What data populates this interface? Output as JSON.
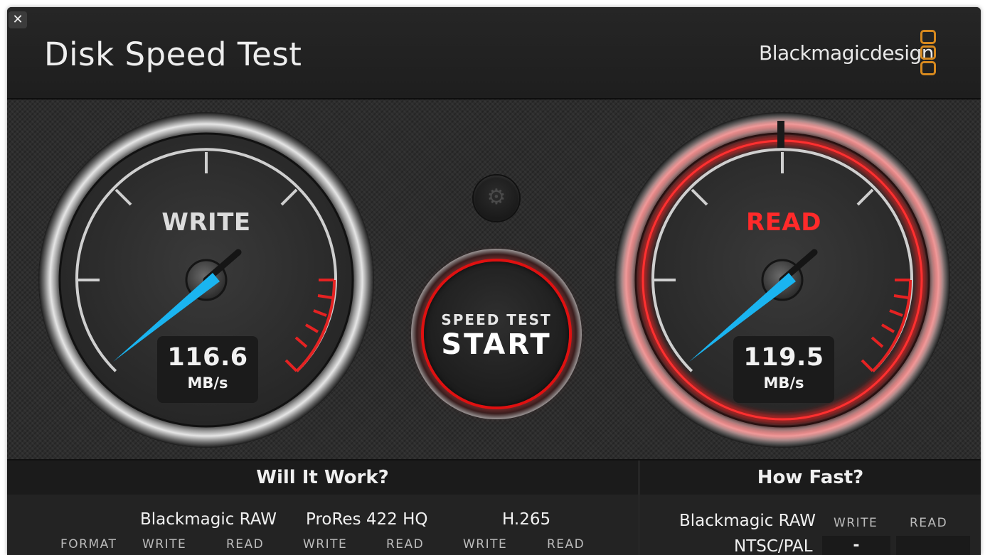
{
  "window": {
    "close_glyph": "✕"
  },
  "header": {
    "title": "Disk Speed Test",
    "brand": "Blackmagicdesign"
  },
  "gauges": {
    "write": {
      "label": "WRITE",
      "value": "116.6",
      "unit": "MB/s",
      "label_color": "#dcdcdc"
    },
    "read": {
      "label": "READ",
      "value": "119.5",
      "unit": "MB/s",
      "label_color": "#ff2a2a"
    }
  },
  "settings": {
    "icon": "gear-icon",
    "glyph": "⚙"
  },
  "start": {
    "top_label": "SPEED TEST",
    "main_label": "START"
  },
  "will_it_work": {
    "title": "Will It Work?",
    "format_label": "FORMAT",
    "formats": [
      {
        "name": "Blackmagic RAW",
        "write": "WRITE",
        "read": "READ"
      },
      {
        "name": "ProRes 422 HQ",
        "write": "WRITE",
        "read": "READ"
      },
      {
        "name": "H.265",
        "write": "WRITE",
        "read": "READ"
      }
    ]
  },
  "how_fast": {
    "title": "How Fast?",
    "format": "Blackmagic RAW",
    "write_col": "WRITE",
    "read_col": "READ",
    "row_label": "NTSC/PAL",
    "row_write": "-"
  },
  "colors": {
    "accent_red": "#e01010",
    "needle_blue": "#1ab4f0",
    "brand_orange": "#d7891e"
  }
}
